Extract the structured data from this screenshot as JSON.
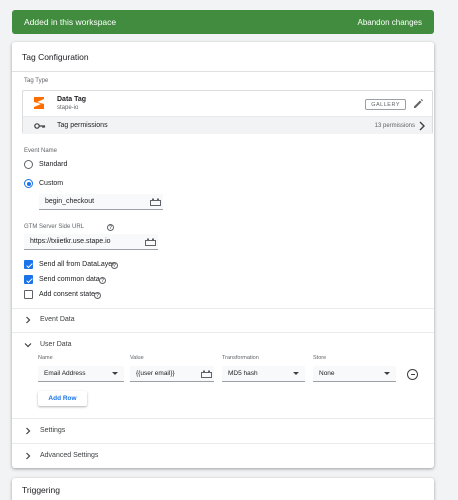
{
  "banner": {
    "message": "Added in this workspace",
    "action": "Abandon changes",
    "color": "#418c3e"
  },
  "card": {
    "title": "Tag Configuration",
    "tag_type_label": "Tag Type",
    "tag": {
      "name": "Data Tag",
      "vendor": "stape-io",
      "gallery_label": "GALLERY",
      "icon": "stape-logo-icon"
    },
    "permissions": {
      "label": "Tag permissions",
      "count": "13 permissions"
    },
    "event_name": {
      "label": "Event Name",
      "options": [
        {
          "label": "Standard",
          "selected": false
        },
        {
          "label": "Custom",
          "selected": true
        }
      ],
      "custom_value": "begin_checkout"
    },
    "server_url": {
      "label": "GTM Server Side URL",
      "value": "https://txiietkr.use.stape.io"
    },
    "checkboxes": [
      {
        "label": "Send all from DataLayer",
        "checked": true
      },
      {
        "label": "Send common data",
        "checked": true
      },
      {
        "label": "Add consent state",
        "checked": false
      }
    ],
    "sections": {
      "event_data": "Event Data",
      "user_data": "User Data",
      "settings": "Settings",
      "advanced": "Advanced Settings"
    },
    "user_data_table": {
      "headers": [
        "Name",
        "Value",
        "Transformation",
        "Store"
      ],
      "row": {
        "name": "Email Address",
        "value": "{{user email}}",
        "transformation": "MD5 hash",
        "store": "None"
      },
      "add_row": "Add Row"
    }
  },
  "triggering": {
    "title": "Triggering"
  },
  "colors": {
    "accent": "#1a73e8",
    "stape": "#ff6d00"
  }
}
